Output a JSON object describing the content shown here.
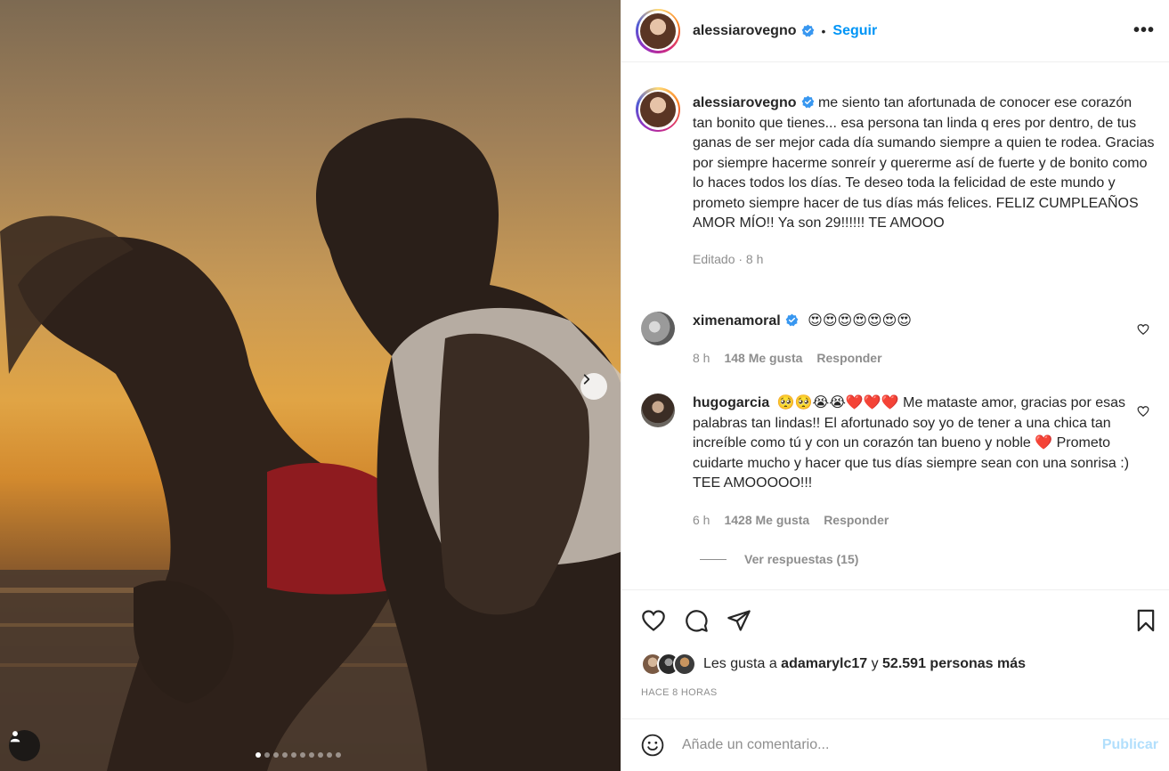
{
  "post": {
    "username": "alessiarovegno",
    "follow_label": "Seguir",
    "more_label": "•••",
    "caption": "me siento tan afortunada de conocer ese corazón tan bonito que tienes... esa persona tan linda q eres por dentro, de tus ganas de ser mejor cada día sumando siempre a quien te rodea. Gracias por siempre hacerme sonreír y quererme así de fuerte y de bonito como lo haces todos los días. Te deseo toda la felicidad de este mundo y prometo siempre hacer de tus días más felices. FELIZ CUMPLEAÑOS AMOR MÍO!! Ya son 29!!!!!! TE AMOOO",
    "caption_meta": "Editado · 8 h",
    "carousel": {
      "slides": 10,
      "active_index": 0
    }
  },
  "comments": [
    {
      "username": "ximenamoral",
      "text": "😍😍😍😍😍😍😍",
      "time": "8 h",
      "likes": "148 Me gusta",
      "reply_label": "Responder"
    },
    {
      "username": "hugogarcia",
      "text": "🥺🥺😭😭❤️❤️❤️ Me mataste amor, gracias por esas palabras tan lindas!! El afortunado soy yo de tener a una chica tan increíble como tú y con un corazón tan bueno y noble ❤️ Prometo cuidarte mucho y hacer que tus días siempre sean con una sonrisa :) TEE AMOOOOO!!!",
      "time": "6 h",
      "likes": "1428 Me gusta",
      "reply_label": "Responder"
    }
  ],
  "view_replies": "Ver respuestas (15)",
  "likes_summary": {
    "prefix": "Les gusta a ",
    "user": "adamarylc17",
    "middle": " y ",
    "others": "52.591 personas más"
  },
  "timestamp": "HACE 8 HORAS",
  "comment_box": {
    "placeholder": "Añade un comentario...",
    "publish_label": "Publicar"
  },
  "colors": {
    "accent": "#0095f6",
    "publish_disabled": "#b2dffc",
    "heart": "#ed4956",
    "secondary_text": "#8e8e8e"
  },
  "icons": [
    "verified-badge-icon",
    "heart-icon",
    "comment-icon",
    "share-icon",
    "save-icon",
    "emoji-icon",
    "chevron-right-icon",
    "user-tag-icon"
  ]
}
